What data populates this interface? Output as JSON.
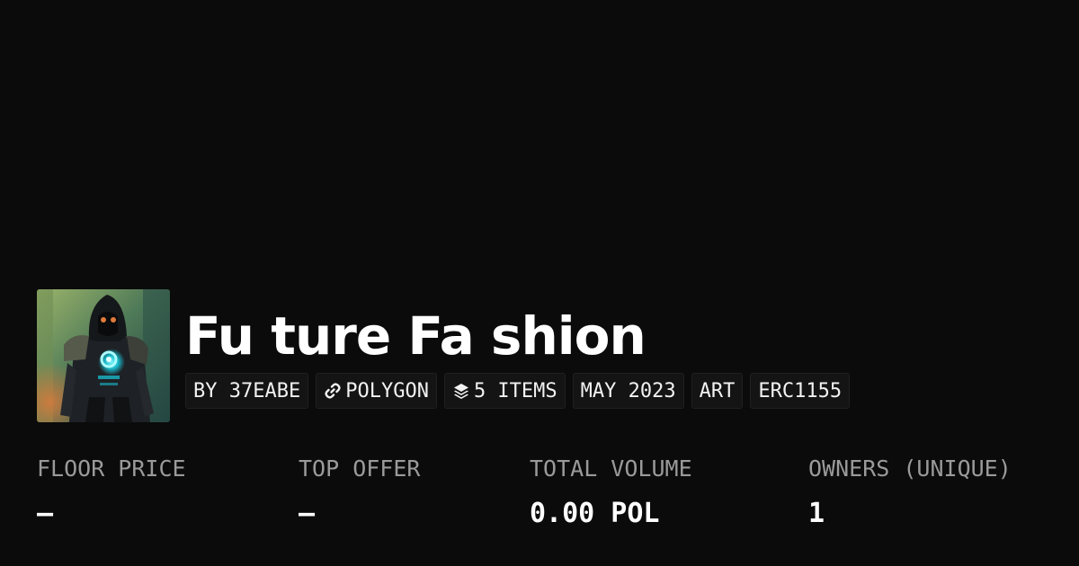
{
  "collection": {
    "title": "Fu ture Fa shion",
    "image_alt": "cyberpunk hooded figure artwork"
  },
  "tags": [
    {
      "label": "BY 37EABE"
    },
    {
      "label": "POLYGON",
      "icon": "chain-link-icon"
    },
    {
      "label": "5 ITEMS",
      "icon": "layers-icon"
    },
    {
      "label": "MAY 2023"
    },
    {
      "label": "ART"
    },
    {
      "label": "ERC1155"
    }
  ],
  "stats": [
    {
      "label": "FLOOR PRICE",
      "value": "–"
    },
    {
      "label": "TOP OFFER",
      "value": "–"
    },
    {
      "label": "TOTAL VOLUME",
      "value": "0.00 POL"
    },
    {
      "label": "OWNERS (UNIQUE)",
      "value": "1"
    }
  ],
  "colors": {
    "background": "#0b0b0b",
    "tag_background": "#141414",
    "label_gray": "#9a9a9a",
    "text_white": "#ffffff"
  }
}
